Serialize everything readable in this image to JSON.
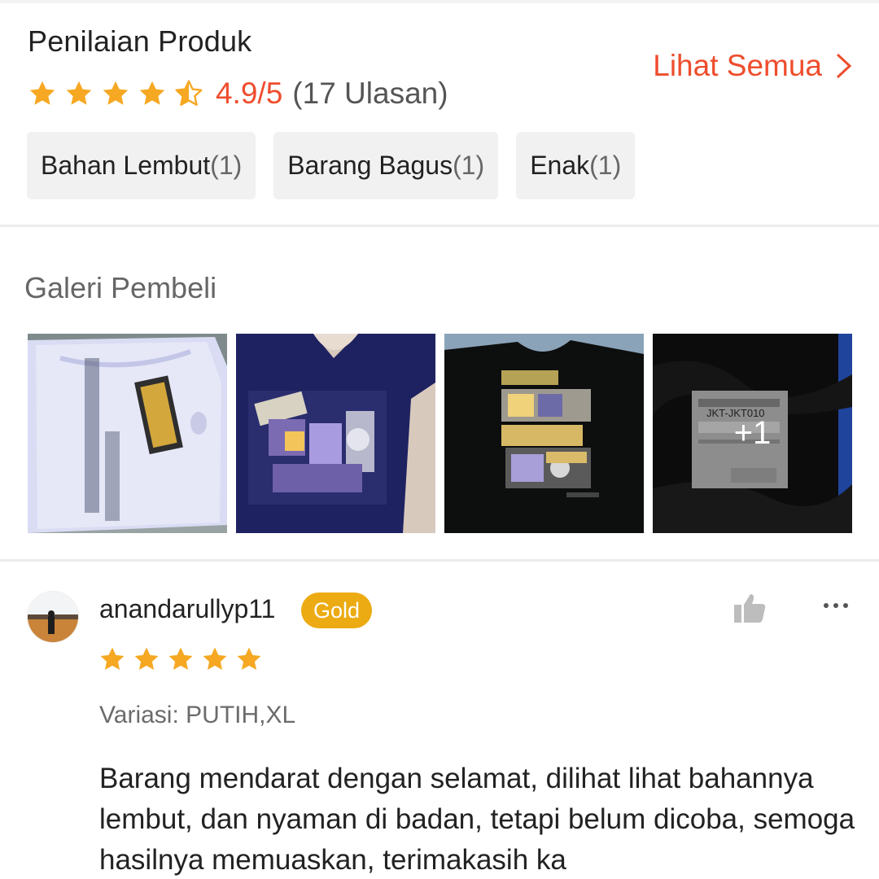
{
  "rating": {
    "title": "Penilaian Produk",
    "see_all_label": "Lihat Semua",
    "stars_value": 4.5,
    "score": "4.9/5",
    "count": "(17 Ulasan)",
    "accent_color": "#ee4d2d",
    "star_color": "#f6a823"
  },
  "tags": [
    {
      "label": "Bahan Lembut",
      "count": "(1)"
    },
    {
      "label": "Barang Bagus",
      "count": "(1)"
    },
    {
      "label": "Enak",
      "count": "(1)"
    }
  ],
  "gallery": {
    "title": "Galeri Pembeli",
    "images": [
      {
        "name": "white-shirt-photo"
      },
      {
        "name": "navy-shirt-photo"
      },
      {
        "name": "black-shirt-photo"
      },
      {
        "name": "package-photo",
        "overlay": "+1"
      }
    ],
    "package_label_text": "JKT-JKT010"
  },
  "review": {
    "username": "anandarullyp11",
    "badge": "Gold",
    "badge_color": "#ecab12",
    "stars_value": 5,
    "variant": "Variasi: PUTIH,XL",
    "text": "Barang mendarat dengan selamat, dilihat lihat bahannya lembut, dan nyaman di badan, tetapi belum dicoba, semoga hasilnya memuaskan, terimakasih ka",
    "icons": [
      "thumbs-up-icon",
      "more-options-icon"
    ]
  }
}
